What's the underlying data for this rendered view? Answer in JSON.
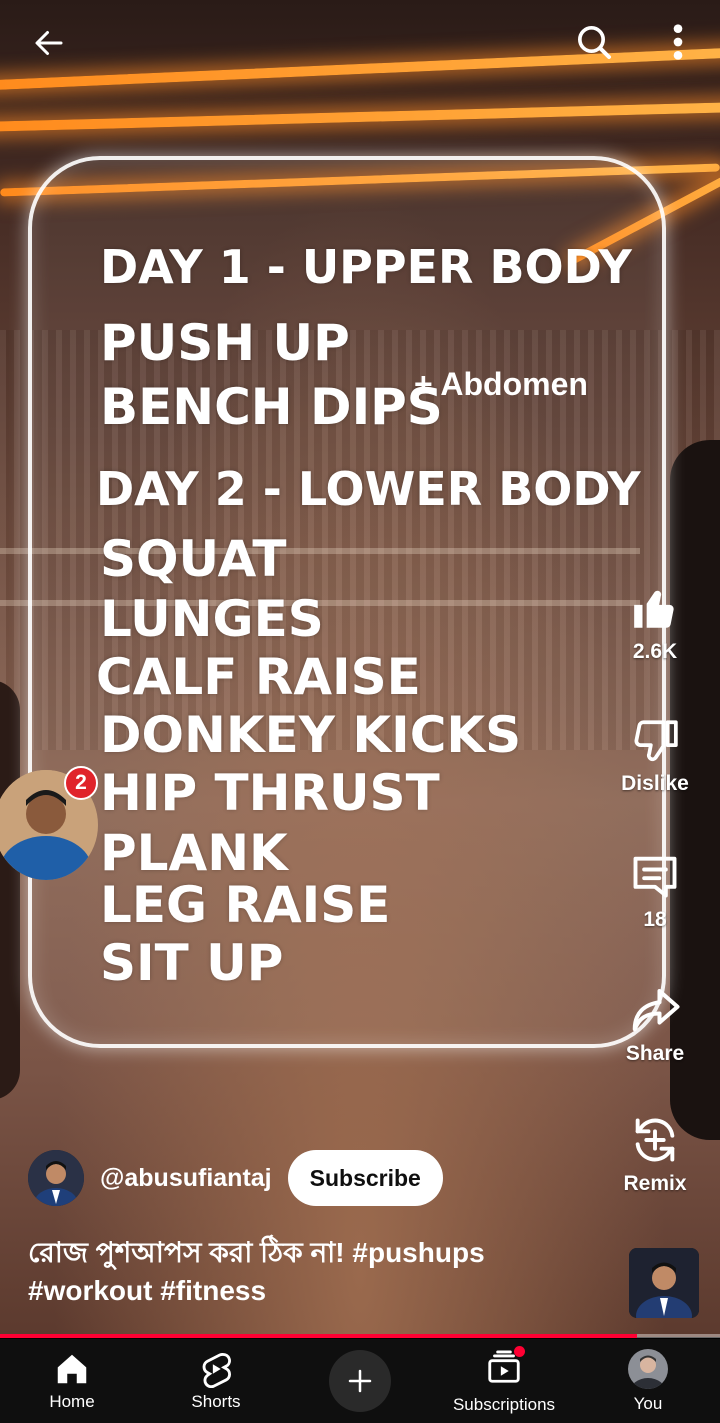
{
  "video": {
    "overlay_lines": [
      "DAY 1 - UPPER BODY",
      "PUSH UP",
      "BENCH DIPS",
      "DAY 2 - LOWER BODY",
      "SQUAT",
      "LUNGES",
      "CALF RAISE",
      "DONKEY KICKS",
      "HIP THRUST",
      "PLANK",
      "LEG RAISE",
      "SIT UP"
    ],
    "overlay_note": "+ Abdomen",
    "progress_fraction": 0.885
  },
  "floating_avatar": {
    "badge_count": "2"
  },
  "actions": {
    "like_count": "2.6K",
    "dislike_label": "Dislike",
    "comment_count": "18",
    "share_label": "Share",
    "remix_label": "Remix"
  },
  "channel": {
    "handle": "@abusufiantaj",
    "subscribe_label": "Subscribe"
  },
  "caption": {
    "text": "রোজ পুশআপস করা ঠিক না!",
    "hashtags_line1": "#pushups",
    "hashtags_line2": "#workout #fitness"
  },
  "nav": {
    "items": [
      {
        "label": "Home",
        "icon": "home-icon"
      },
      {
        "label": "Shorts",
        "icon": "shorts-icon"
      },
      {
        "label": "",
        "icon": "plus-icon"
      },
      {
        "label": "Subscriptions",
        "icon": "subscriptions-icon"
      },
      {
        "label": "You",
        "icon": "avatar"
      }
    ]
  },
  "colors": {
    "accent": "#ff0033",
    "badge": "#e0242b",
    "nav_bg": "#0f0f0f"
  }
}
